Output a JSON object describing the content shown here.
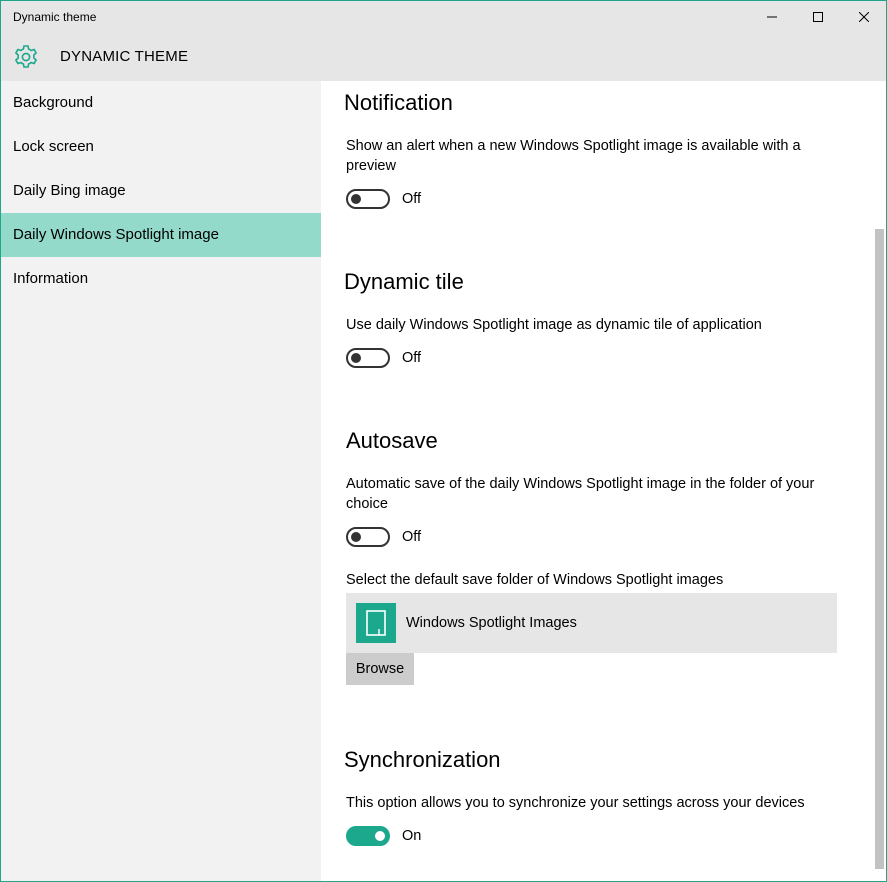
{
  "window": {
    "title": "Dynamic theme"
  },
  "header": {
    "app_title": "DYNAMIC THEME",
    "icon": "gear-icon"
  },
  "sidebar": {
    "items": [
      {
        "label": "Background"
      },
      {
        "label": "Lock screen"
      },
      {
        "label": "Daily Bing image"
      },
      {
        "label": "Daily Windows Spotlight image",
        "active": true
      },
      {
        "label": "Information"
      }
    ]
  },
  "sections": {
    "notification": {
      "title": "Notification",
      "description": "Show an alert when a new Windows Spotlight image is available with a preview",
      "toggle_state": "Off"
    },
    "dynamic_tile": {
      "title": "Dynamic tile",
      "description": "Use daily Windows Spotlight image as dynamic tile of application",
      "toggle_state": "Off"
    },
    "autosave": {
      "title": "Autosave",
      "description": "Automatic save of the daily Windows Spotlight image in the folder of your choice",
      "toggle_state": "Off",
      "folder_prompt": "Select the default save folder of Windows Spotlight images",
      "folder_name": "Windows Spotlight Images",
      "browse_label": "Browse"
    },
    "synchronization": {
      "title": "Synchronization",
      "description": "This option allows you to synchronize your settings across your devices",
      "toggle_state": "On"
    }
  },
  "colors": {
    "accent": "#1ca88c",
    "nav_active": "#93dacb",
    "header_bg": "#e6e6e6",
    "sidebar_bg": "#f2f2f2"
  }
}
